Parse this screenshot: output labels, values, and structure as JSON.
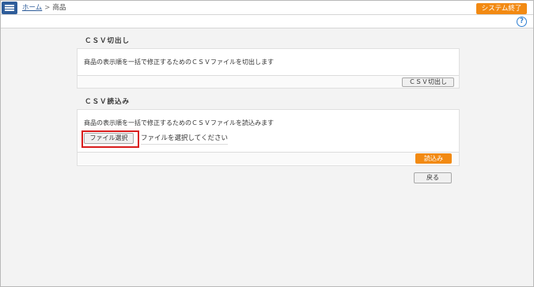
{
  "header": {
    "breadcrumb_home": "ホーム",
    "breadcrumb_sep": ">",
    "breadcrumb_current": "商品",
    "exit_label": "システム終了",
    "help_glyph": "?"
  },
  "export_section": {
    "title": "ＣＳＶ切出し",
    "description": "商品の表示順を一括で修正するためのＣＳＶファイルを切出します",
    "button_label": "ＣＳＶ切出し"
  },
  "import_section": {
    "title": "ＣＳＶ読込み",
    "description": "商品の表示順を一括で修正するためのＣＳＶファイルを読込みます",
    "file_button_label": "ファイル選択",
    "file_status": "ファイルを選択してください",
    "submit_label": "読込み"
  },
  "back_label": "戻る",
  "colors": {
    "accent": "#f28a13",
    "nav": "#2f5d9a",
    "highlight": "#d91d1d"
  }
}
